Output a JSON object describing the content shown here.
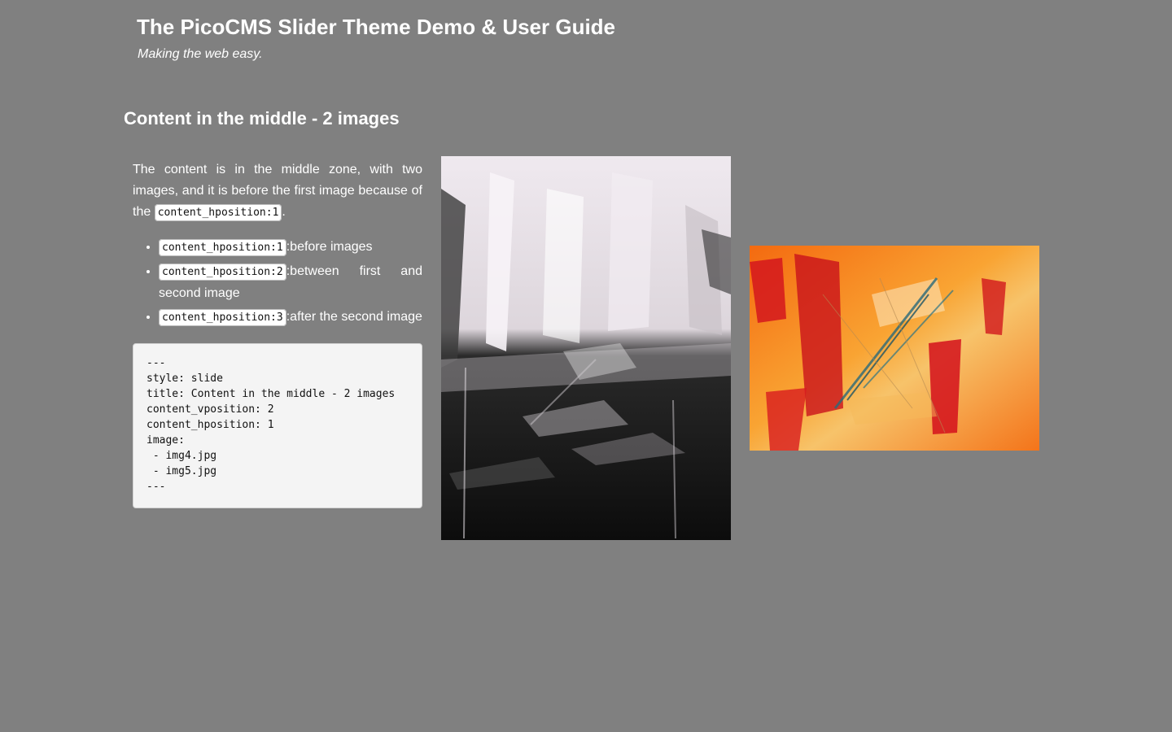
{
  "header": {
    "title": "The PicoCMS Slider Theme Demo & User Guide",
    "tagline": "Making the web easy."
  },
  "slide": {
    "title": "Content in the middle - 2 images",
    "intro_before": "The content is in the middle zone, with two images, and it is before the first image because of the ",
    "intro_code": "content_hposition:1",
    "intro_after": ".",
    "options": [
      {
        "code": "content_hposition:1",
        "text": ":before images"
      },
      {
        "code": "content_hposition:2",
        "text": ":between first and second image"
      },
      {
        "code": "content_hposition:3",
        "text": ":after the second image"
      }
    ],
    "code_block": "---\nstyle: slide\ntitle: Content in the middle - 2 images\ncontent_vposition: 2\ncontent_hposition: 1\nimage:\n - img4.jpg\n - img5.jpg\n---"
  },
  "images": [
    {
      "name": "black-white-abstract-painting",
      "colors": [
        "#ece6ec",
        "#1a1a1a"
      ]
    },
    {
      "name": "orange-red-abstract-painting",
      "colors": [
        "#f7941d",
        "#d3101c"
      ]
    }
  ]
}
